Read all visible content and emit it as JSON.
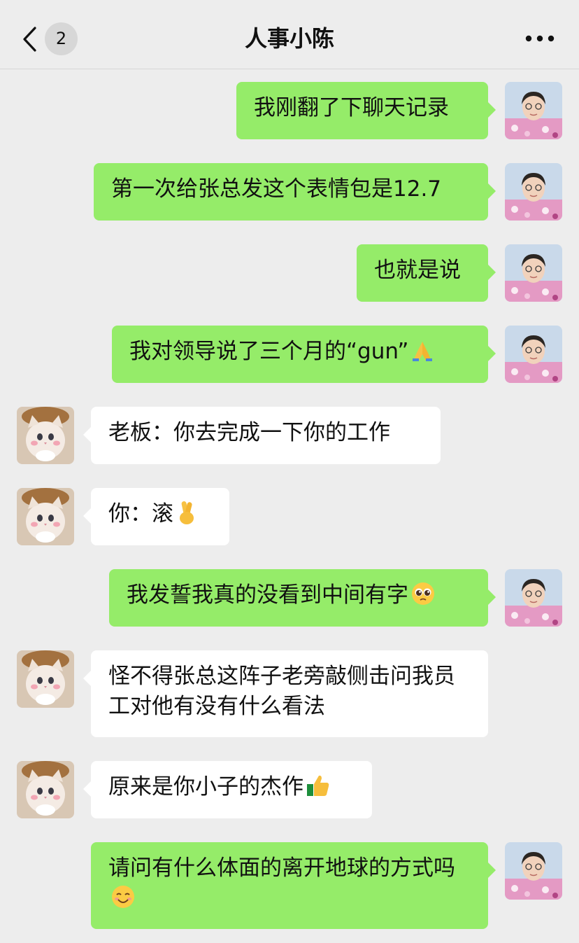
{
  "header": {
    "back_icon": "chevron-left-icon",
    "unread_count": "2",
    "title": "人事小陈",
    "more_icon": "ellipsis-icon"
  },
  "colors": {
    "background": "#ededed",
    "my_bubble": "#95ec69",
    "their_bubble": "#ffffff"
  },
  "messages": [
    {
      "sender": "me",
      "avatar": "woman-photo-avatar",
      "text": "我刚翻了下聊天记录",
      "emoji": ""
    },
    {
      "sender": "me",
      "avatar": "woman-photo-avatar",
      "text": "第一次给张总发这个表情包是12.7",
      "emoji": ""
    },
    {
      "sender": "me",
      "avatar": "woman-photo-avatar",
      "text": "也就是说",
      "emoji": ""
    },
    {
      "sender": "me",
      "avatar": "woman-photo-avatar",
      "text": "我对领导说了三个月的“gun”",
      "emoji": "folded-hands-emoji"
    },
    {
      "sender": "other",
      "avatar": "cat-photo-avatar",
      "text": "老板：你去完成一下你的工作",
      "emoji": ""
    },
    {
      "sender": "other",
      "avatar": "cat-photo-avatar",
      "text": "你：滚",
      "emoji": "crossed-fingers-emoji"
    },
    {
      "sender": "me",
      "avatar": "woman-photo-avatar",
      "text": "我发誓我真的没看到中间有字",
      "emoji": "pleading-face-emoji"
    },
    {
      "sender": "other",
      "avatar": "cat-photo-avatar",
      "text": "怪不得张总这阵子老旁敲侧击问我员工对他有没有什么看法",
      "emoji": ""
    },
    {
      "sender": "other",
      "avatar": "cat-photo-avatar",
      "text": "原来是你小子的杰作",
      "emoji": "thumbs-up-emoji"
    },
    {
      "sender": "me",
      "avatar": "woman-photo-avatar",
      "text": "请问有什么体面的离开地球的方式吗",
      "emoji": "smiling-face-emoji"
    }
  ]
}
